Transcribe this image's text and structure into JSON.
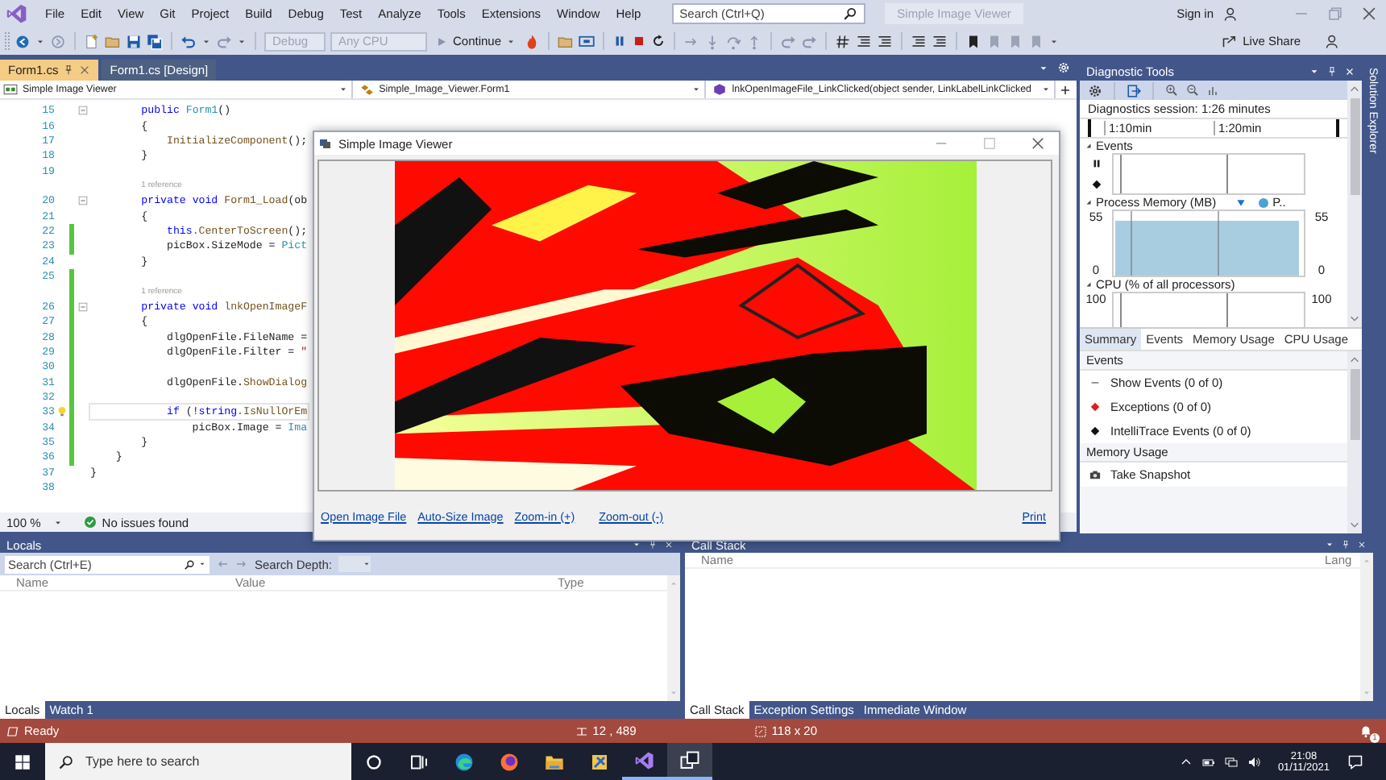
{
  "title_bar": {
    "menu": [
      "File",
      "Edit",
      "View",
      "Git",
      "Project",
      "Build",
      "Debug",
      "Test",
      "Analyze",
      "Tools",
      "Extensions",
      "Window",
      "Help"
    ],
    "search": {
      "placeholder": "Search (Ctrl+Q)"
    },
    "solution_title": "Simple Image Viewer",
    "sign_in": "Sign in"
  },
  "toolbar": {
    "configuration": {
      "value": "Debug",
      "disabled": true
    },
    "platform": {
      "value": "Any CPU",
      "disabled": true
    },
    "continue": "Continue",
    "live_share": "Live Share"
  },
  "document_tabs": [
    {
      "label": "Form1.cs",
      "selected": true
    },
    {
      "label": "Form1.cs [Design]",
      "selected": false
    }
  ],
  "navigation_bar": [
    "Simple Image Viewer",
    "Simple_Image_Viewer.Form1",
    "lnkOpenImageFile_LinkClicked(object sender, LinkLabelLinkClicked"
  ],
  "editor": {
    "lines": [
      {
        "kind": "code",
        "number": "15",
        "fold": true,
        "changed": false,
        "tokens": [
          {
            "text": "        public",
            "kind": "keyword"
          },
          {
            "text": " Form1",
            "kind": "type"
          },
          {
            "text": "()",
            "kind": "plain"
          }
        ]
      },
      {
        "kind": "code",
        "number": "16",
        "changed": false,
        "tokens": [
          {
            "text": "        {",
            "kind": "plain"
          }
        ]
      },
      {
        "kind": "code",
        "number": "17",
        "changed": false,
        "tokens": [
          {
            "text": "            InitializeComponent",
            "kind": "method"
          },
          {
            "text": "();",
            "kind": "plain"
          }
        ]
      },
      {
        "kind": "code",
        "number": "18",
        "changed": false,
        "tokens": [
          {
            "text": "        }",
            "kind": "plain"
          }
        ]
      },
      {
        "kind": "code",
        "number": "19",
        "changed": false
      },
      {
        "kind": "reference",
        "text": "1 reference",
        "changed": false
      },
      {
        "kind": "code",
        "number": "20",
        "fold": true,
        "changed": false,
        "tokens": [
          {
            "text": "        private",
            "kind": "keyword"
          },
          {
            "text": " void",
            "kind": "keyword"
          },
          {
            "text": " Form1_Load",
            "kind": "method"
          },
          {
            "text": "(ob",
            "kind": "plain"
          }
        ]
      },
      {
        "kind": "code",
        "number": "21",
        "changed": false,
        "tokens": [
          {
            "text": "        {",
            "kind": "plain"
          }
        ]
      },
      {
        "kind": "code",
        "number": "22",
        "changed": true,
        "tokens": [
          {
            "text": "            this",
            "kind": "keyword"
          },
          {
            "text": ".CenterToScreen",
            "kind": "method"
          },
          {
            "text": "();",
            "kind": "plain"
          }
        ]
      },
      {
        "kind": "code",
        "number": "23",
        "changed": true,
        "tokens": [
          {
            "text": "            picBox.SizeMode =",
            "kind": "plain"
          },
          {
            "text": " Pict",
            "kind": "type"
          }
        ]
      },
      {
        "kind": "code",
        "number": "24",
        "changed": false,
        "tokens": [
          {
            "text": "        }",
            "kind": "plain"
          }
        ]
      },
      {
        "kind": "code",
        "number": "25",
        "changed": true
      },
      {
        "kind": "reference",
        "text": "1 reference",
        "changed": true
      },
      {
        "kind": "code",
        "number": "26",
        "fold": true,
        "changed": true,
        "tokens": [
          {
            "text": "        private",
            "kind": "keyword"
          },
          {
            "text": " void",
            "kind": "keyword"
          },
          {
            "text": " lnkOpenImageF",
            "kind": "method"
          }
        ]
      },
      {
        "kind": "code",
        "number": "27",
        "changed": true,
        "tokens": [
          {
            "text": "        {",
            "kind": "plain"
          }
        ]
      },
      {
        "kind": "code",
        "number": "28",
        "changed": true,
        "tokens": [
          {
            "text": "            dlgOpenFile.FileName =",
            "kind": "plain"
          }
        ]
      },
      {
        "kind": "code",
        "number": "29",
        "changed": true,
        "tokens": [
          {
            "text": "            dlgOpenFile.Filter =",
            "kind": "plain"
          },
          {
            "text": " \"",
            "kind": "string"
          }
        ]
      },
      {
        "kind": "code",
        "number": "30",
        "changed": true
      },
      {
        "kind": "code",
        "number": "31",
        "changed": true,
        "tokens": [
          {
            "text": "            dlgOpenFile.",
            "kind": "plain"
          },
          {
            "text": "ShowDialog",
            "kind": "method"
          }
        ]
      },
      {
        "kind": "code",
        "number": "32",
        "changed": true
      },
      {
        "kind": "code",
        "number": "33",
        "changed": true,
        "lightbulb": true,
        "current": true,
        "tokens": [
          {
            "text": "            if",
            "kind": "keyword"
          },
          {
            "text": " (!",
            "kind": "plain"
          },
          {
            "text": "string",
            "kind": "keyword"
          },
          {
            "text": ".IsNullOrEm",
            "kind": "method"
          }
        ]
      },
      {
        "kind": "code",
        "number": "34",
        "changed": true,
        "tokens": [
          {
            "text": "                picBox.Image =",
            "kind": "plain"
          },
          {
            "text": " Ima",
            "kind": "type"
          }
        ]
      },
      {
        "kind": "code",
        "number": "35",
        "changed": true,
        "tokens": [
          {
            "text": "        }",
            "kind": "plain"
          }
        ]
      },
      {
        "kind": "code",
        "number": "36",
        "changed": true,
        "tokens": [
          {
            "text": "    }",
            "kind": "plain"
          }
        ]
      },
      {
        "kind": "code",
        "number": "37",
        "changed": false,
        "tokens": [
          {
            "text": "}",
            "kind": "plain"
          }
        ]
      },
      {
        "kind": "code",
        "number": "38",
        "changed": false
      }
    ],
    "zoom": "100 %",
    "issues": "No issues found"
  },
  "app_window": {
    "title": "Simple Image Viewer",
    "links": [
      "Open Image File",
      "Auto-Size Image",
      "Zoom-in (+)",
      "Zoom-out (-)"
    ],
    "print_link": "Print"
  },
  "diagnostic_tools": {
    "title": "Diagnostic Tools",
    "session": "Diagnostics session: 1:26 minutes",
    "ruler": [
      "1:10min",
      "1:20min"
    ],
    "events_title": "Events",
    "memory": {
      "title": "Process Memory (MB)",
      "legend_label": "P..",
      "left_axis_labels": [
        "55",
        "0"
      ],
      "right_axis_labels": [
        "55",
        "0"
      ]
    },
    "cpu": {
      "title": "CPU (% of all processors)",
      "left_label": "100",
      "right_label": "100"
    },
    "tabs": [
      {
        "label": "Summary",
        "selected": true
      },
      {
        "label": "Events",
        "selected": false
      },
      {
        "label": "Memory Usage",
        "selected": false
      },
      {
        "label": "CPU Usage",
        "selected": false
      }
    ],
    "summary": [
      {
        "kind": "header",
        "text": "Events"
      },
      {
        "kind": "show_events",
        "text": "Show Events (0 of 0)"
      },
      {
        "kind": "exceptions",
        "text": "Exceptions (0 of 0)"
      },
      {
        "kind": "intellitrace",
        "text": "IntelliTrace Events (0 of 0)"
      },
      {
        "kind": "header",
        "text": "Memory Usage"
      },
      {
        "kind": "snapshot",
        "text": "Take Snapshot"
      }
    ]
  },
  "side_tab": "Solution Explorer",
  "locals": {
    "title": "Locals",
    "search": {
      "placeholder": "Search (Ctrl+E)"
    },
    "search_depth": "Search Depth:",
    "columns": [
      "Name",
      "Value",
      "Type"
    ],
    "tabs": [
      {
        "label": "Locals",
        "selected": true
      },
      {
        "label": "Watch 1",
        "selected": false
      }
    ]
  },
  "call_stack": {
    "title": "Call Stack",
    "columns": [
      "Name",
      "Lang"
    ],
    "tabs": [
      {
        "label": "Call Stack",
        "selected": true
      },
      {
        "label": "Exception Settings",
        "selected": false
      },
      {
        "label": "Immediate Window",
        "selected": false
      }
    ]
  },
  "status_bar": {
    "message": "Ready",
    "position": "12 , 489",
    "size": "118 x 20",
    "notifications": "1"
  },
  "taskbar": {
    "search": {
      "placeholder": "Type here to search"
    },
    "time": "21:08",
    "date": "01/11/2021"
  }
}
